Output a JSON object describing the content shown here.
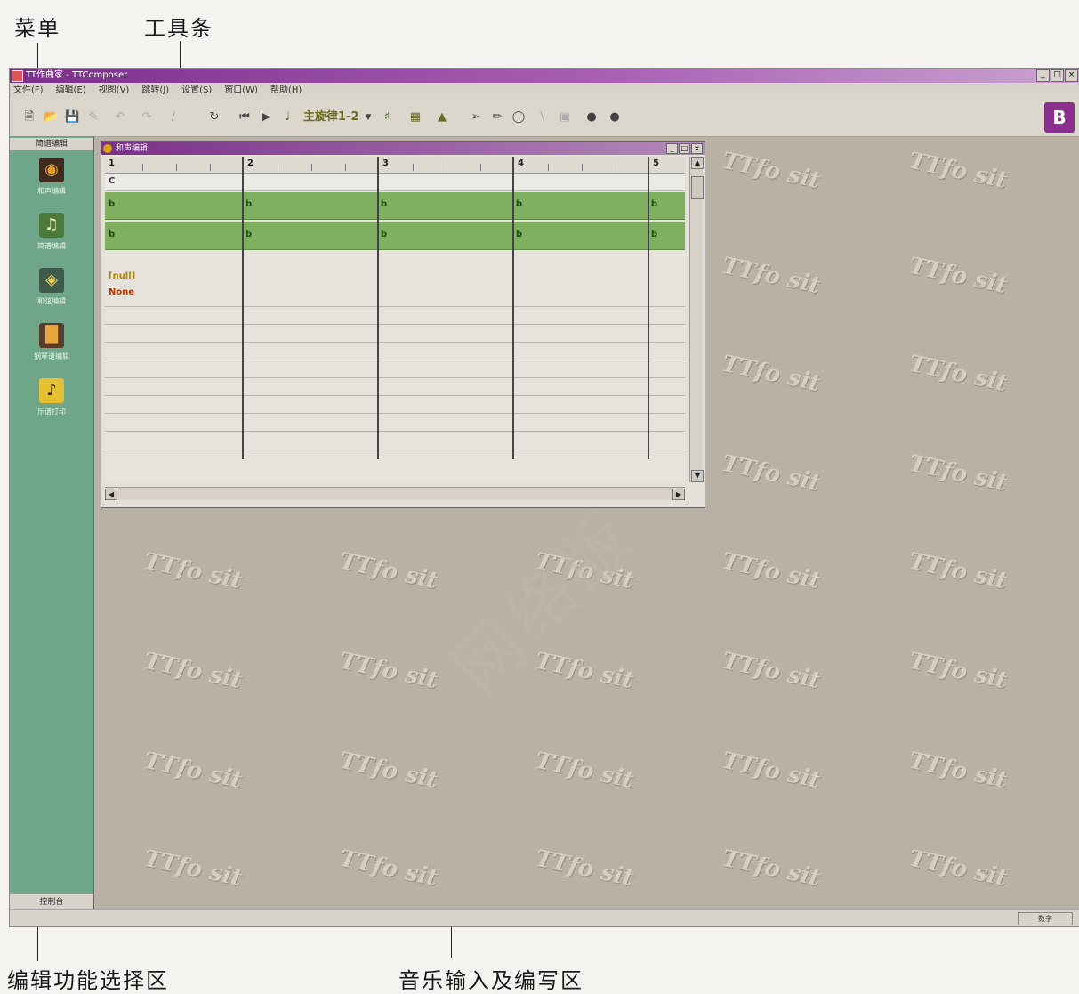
{
  "annotations": {
    "menu": "菜单",
    "toolbar": "工具条",
    "edit_area": "编辑功能选择区",
    "music_area": "音乐输入及编写区"
  },
  "window": {
    "title": "TT作曲家 - TTComposer"
  },
  "menu": [
    "文件(F)",
    "编辑(E)",
    "视图(V)",
    "跳转(J)",
    "设置(S)",
    "窗口(W)",
    "帮助(H)"
  ],
  "toolbar": {
    "track_selector": "主旋律1-2"
  },
  "sidebar": {
    "header": "简谱编辑",
    "items": [
      {
        "label": "和声编辑"
      },
      {
        "label": "简谱编辑"
      },
      {
        "label": "和弦编辑"
      },
      {
        "label": "钢琴谱编辑"
      },
      {
        "label": "乐谱打印"
      }
    ],
    "footer": "控制台"
  },
  "child_window": {
    "title": "和声编辑",
    "measures": [
      "1",
      "2",
      "3",
      "4",
      "5"
    ],
    "key_label": "C",
    "pattern_label": "b",
    "null_label": "[null]",
    "none_label": "None"
  },
  "statusbar": {
    "right_cell": "数字"
  },
  "watermark": {
    "center_text": "网络版",
    "tile_text": "TTfo sit"
  }
}
